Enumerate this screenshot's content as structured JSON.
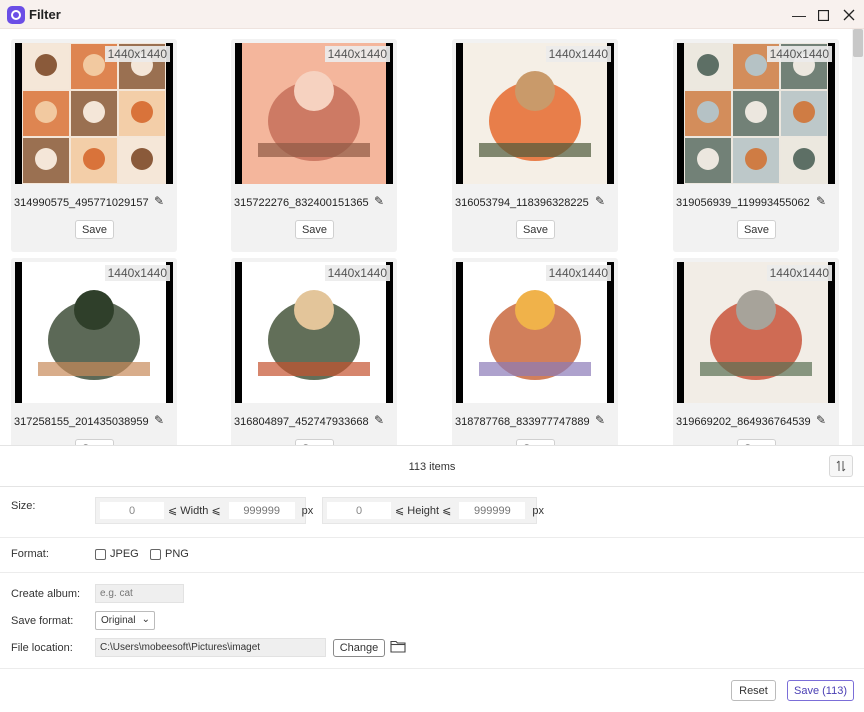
{
  "window": {
    "title": "Filter"
  },
  "grid": {
    "cards": [
      {
        "dimensions": "1440x1440",
        "name": "314990575_495771029157",
        "save_label": "Save",
        "palette": [
          "#f4e6d8",
          "#d9733a",
          "#8a5a3a",
          "#f2c9a0"
        ]
      },
      {
        "dimensions": "1440x1440",
        "name": "315722276_832400151365",
        "save_label": "Save",
        "palette": [
          "#f4b69c",
          "#c6705a",
          "#8e5a45",
          "#f6d2c0"
        ]
      },
      {
        "dimensions": "1440x1440",
        "name": "316053794_118396328225",
        "save_label": "Save",
        "palette": [
          "#f5efe6",
          "#e56a2e",
          "#4f5a3a",
          "#c99a6a"
        ]
      },
      {
        "dimensions": "1440x1440",
        "name": "319056939_119993455062",
        "save_label": "Save",
        "palette": [
          "#ece7df",
          "#cf7c44",
          "#5d6f65",
          "#b5c2c5"
        ]
      },
      {
        "dimensions": "1440x1440",
        "name": "317258155_201435038959",
        "save_label": "Save",
        "palette": [
          "#ffffff",
          "#3f4f3a",
          "#c88a5a",
          "#2f3f2a"
        ]
      },
      {
        "dimensions": "1440x1440",
        "name": "316804897_452747933668",
        "save_label": "Save",
        "palette": [
          "#ffffff",
          "#46563c",
          "#c4532f",
          "#e3c59a"
        ]
      },
      {
        "dimensions": "1440x1440",
        "name": "318787768_833977747889",
        "save_label": "Save",
        "palette": [
          "#ffffff",
          "#c9693e",
          "#8b7ab8",
          "#f0b24a"
        ]
      },
      {
        "dimensions": "1440x1440",
        "name": "319669202_864936764539",
        "save_label": "Save",
        "palette": [
          "#f2ede6",
          "#c9543a",
          "#5a6f52",
          "#a7a39a"
        ]
      }
    ]
  },
  "status": {
    "items_count": "113 items",
    "sort_icon": "sort-icon"
  },
  "size": {
    "label": "Size:",
    "width_min": "0",
    "width_label": "⩽ Width ⩽",
    "width_max_placeholder": "999999",
    "width_unit": "px",
    "height_min": "0",
    "height_label": "⩽ Height ⩽",
    "height_max_placeholder": "999999",
    "height_unit": "px"
  },
  "format": {
    "label": "Format:",
    "options": [
      {
        "label": "JPEG",
        "checked": false
      },
      {
        "label": "PNG",
        "checked": false
      }
    ]
  },
  "album": {
    "label": "Create album:",
    "placeholder": "e.g. cat"
  },
  "save_format": {
    "label": "Save format:",
    "value": "Original"
  },
  "file_location": {
    "label": "File location:",
    "value": "C:\\Users\\mobeesoft\\Pictures\\imaget",
    "change_label": "Change"
  },
  "footer": {
    "reset_label": "Reset",
    "save_label": "Save (113)"
  },
  "colors": {
    "accent": "#6b4ee6",
    "title_bar": "#f8f1ee",
    "card_bg": "#f2f2f2"
  }
}
